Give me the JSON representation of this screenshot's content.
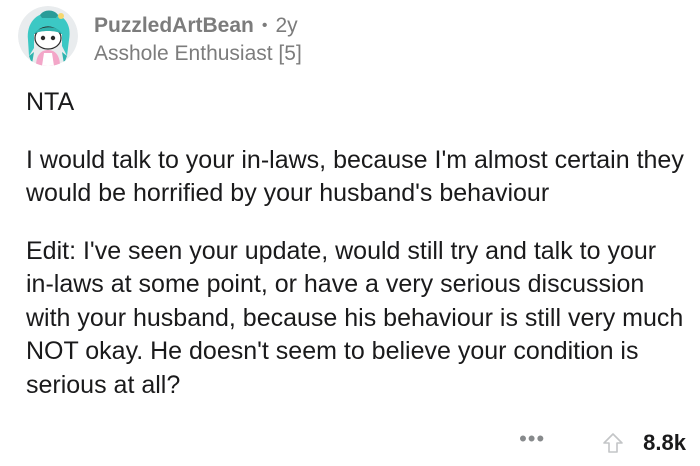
{
  "comment": {
    "author": {
      "username": "PuzzledArtBean",
      "separator": "•",
      "age": "2y",
      "flair": "Asshole Enthusiast [5]",
      "avatar_icon": "snoo-avatar-icon"
    },
    "paragraphs": [
      "NTA",
      "I would talk to your in-laws, because I'm almost certain they would be horrified by your husband's behaviour",
      "Edit: I've seen your update, would still try and talk to your in-laws at some point, or have a very serious discussion with your husband, because his behaviour is still very much NOT okay. He doesn't seem to believe your condition is serious at all?"
    ],
    "actions": {
      "more_label": "•••",
      "more_icon": "more-options-icon",
      "upvote_icon": "upvote-arrow-icon",
      "score": "8.8k"
    }
  },
  "colors": {
    "text": "#1a1a1b",
    "meta": "#7c7c7c",
    "icon": "#878a8c",
    "avatar_teal": "#3cc8c4"
  }
}
